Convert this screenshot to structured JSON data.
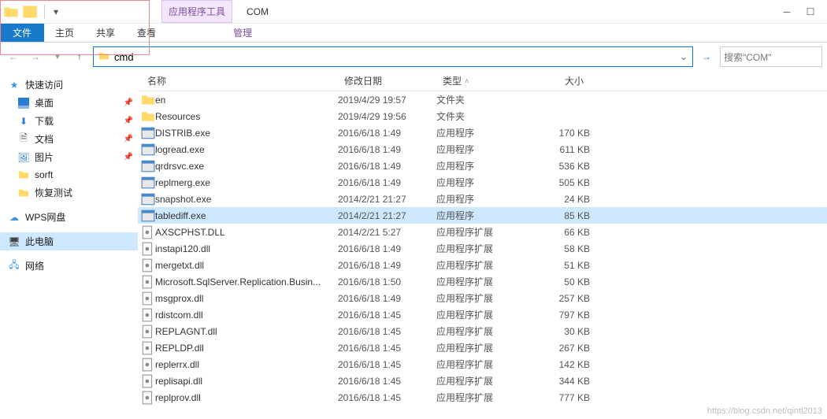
{
  "titlebar": {
    "tools_label": "应用程序工具",
    "title": "COM"
  },
  "menubar": {
    "file": "文件",
    "home": "主页",
    "share": "共享",
    "view": "查看",
    "manage": "管理"
  },
  "address": {
    "value": "cmd",
    "search_placeholder": "搜索\"COM\""
  },
  "columns": {
    "name": "名称",
    "date": "修改日期",
    "type": "类型",
    "size": "大小"
  },
  "sidebar": {
    "quick": "快速访问",
    "desktop": "桌面",
    "downloads": "下载",
    "documents": "文档",
    "pictures": "图片",
    "sorft": "sorft",
    "recovery": "恢复测试",
    "wps": "WPS网盘",
    "pc": "此电脑",
    "network": "网络"
  },
  "files": [
    {
      "icon": "folder",
      "name": "en",
      "date": "2019/4/29 19:57",
      "type": "文件夹",
      "size": ""
    },
    {
      "icon": "folder",
      "name": "Resources",
      "date": "2019/4/29 19:56",
      "type": "文件夹",
      "size": ""
    },
    {
      "icon": "exe",
      "name": "DISTRIB.exe",
      "date": "2016/6/18 1:49",
      "type": "应用程序",
      "size": "170 KB"
    },
    {
      "icon": "exe",
      "name": "logread.exe",
      "date": "2016/6/18 1:49",
      "type": "应用程序",
      "size": "611 KB"
    },
    {
      "icon": "exe",
      "name": "qrdrsvc.exe",
      "date": "2016/6/18 1:49",
      "type": "应用程序",
      "size": "536 KB"
    },
    {
      "icon": "exe",
      "name": "replmerg.exe",
      "date": "2016/6/18 1:49",
      "type": "应用程序",
      "size": "505 KB"
    },
    {
      "icon": "exe",
      "name": "snapshot.exe",
      "date": "2014/2/21 21:27",
      "type": "应用程序",
      "size": "24 KB"
    },
    {
      "icon": "exe",
      "name": "tablediff.exe",
      "date": "2014/2/21 21:27",
      "type": "应用程序",
      "size": "85 KB",
      "selected": true
    },
    {
      "icon": "dll",
      "name": "AXSCPHST.DLL",
      "date": "2014/2/21 5:27",
      "type": "应用程序扩展",
      "size": "66 KB"
    },
    {
      "icon": "dll",
      "name": "instapi120.dll",
      "date": "2016/6/18 1:49",
      "type": "应用程序扩展",
      "size": "58 KB"
    },
    {
      "icon": "dll",
      "name": "mergetxt.dll",
      "date": "2016/6/18 1:49",
      "type": "应用程序扩展",
      "size": "51 KB"
    },
    {
      "icon": "dll",
      "name": "Microsoft.SqlServer.Replication.Busin...",
      "date": "2016/6/18 1:50",
      "type": "应用程序扩展",
      "size": "50 KB"
    },
    {
      "icon": "dll",
      "name": "msgprox.dll",
      "date": "2016/6/18 1:49",
      "type": "应用程序扩展",
      "size": "257 KB"
    },
    {
      "icon": "dll",
      "name": "rdistcom.dll",
      "date": "2016/6/18 1:45",
      "type": "应用程序扩展",
      "size": "797 KB"
    },
    {
      "icon": "dll",
      "name": "REPLAGNT.dll",
      "date": "2016/6/18 1:45",
      "type": "应用程序扩展",
      "size": "30 KB"
    },
    {
      "icon": "dll",
      "name": "REPLDP.dll",
      "date": "2016/6/18 1:45",
      "type": "应用程序扩展",
      "size": "267 KB"
    },
    {
      "icon": "dll",
      "name": "replerrx.dll",
      "date": "2016/6/18 1:45",
      "type": "应用程序扩展",
      "size": "142 KB"
    },
    {
      "icon": "dll",
      "name": "replisapi.dll",
      "date": "2016/6/18 1:45",
      "type": "应用程序扩展",
      "size": "344 KB"
    },
    {
      "icon": "dll",
      "name": "replprov.dll",
      "date": "2016/6/18 1:45",
      "type": "应用程序扩展",
      "size": "777 KB"
    }
  ],
  "watermark": "https://blog.csdn.net/qintl2013"
}
